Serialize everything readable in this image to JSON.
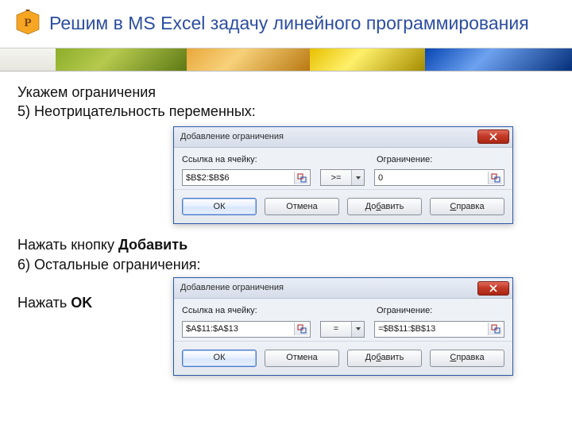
{
  "header": {
    "title": "Решим в MS Excel задачу линейного программирования",
    "logo_letter": "P"
  },
  "body": {
    "line1": "Укажем ограничения",
    "line2": "5) Неотрицательность переменных:",
    "line3a": "Нажать кнопку ",
    "line3b": "Добавить",
    "line4": "6) Остальные ограничения:",
    "line5a": "Нажать ",
    "line5b": "OK"
  },
  "dialog1": {
    "title": "Добавление ограничения",
    "label_cell": "Ссылка на ячейку:",
    "label_constraint": "Ограничение:",
    "cell_ref": "$B$2:$B$6",
    "operator": ">=",
    "constraint": "0",
    "buttons": {
      "ok": "ОК",
      "cancel": "Отмена",
      "add": "Добавить",
      "help": "Справка"
    }
  },
  "dialog2": {
    "title": "Добавление ограничения",
    "label_cell": "Ссылка на ячейку:",
    "label_constraint": "Ограничение:",
    "cell_ref": "$A$11:$A$13",
    "operator": "=",
    "constraint": "=$B$11:$B$13",
    "buttons": {
      "ok": "ОК",
      "cancel": "Отмена",
      "add": "Добавить",
      "help": "Справка"
    }
  }
}
